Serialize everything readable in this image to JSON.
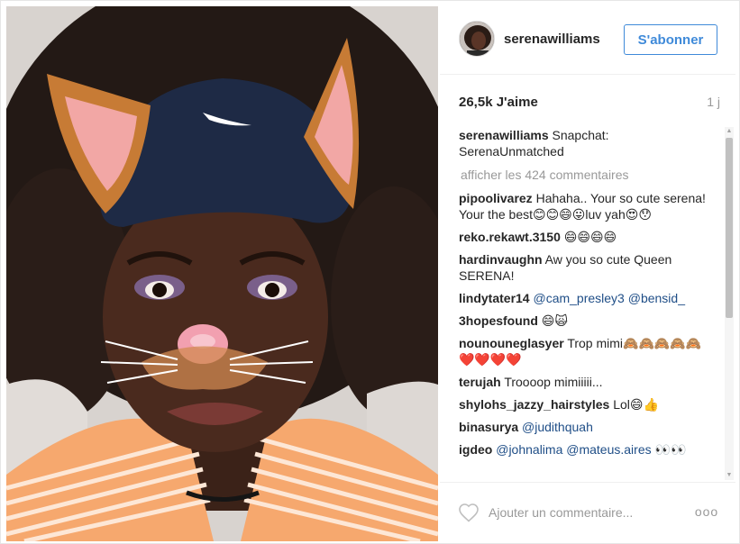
{
  "post": {
    "username": "serenawilliams",
    "follow_label": "S'abonner",
    "likes": "26,5k J'aime",
    "time_ago": "1 j"
  },
  "caption": {
    "username": "serenawilliams",
    "text": " Snapchat: SerenaUnmatched"
  },
  "load_more_label": "afficher les 424 commentaires",
  "comments": [
    {
      "user": "pipoolivarez",
      "text": " Hahaha.. Your so cute serena! Your the best😊😊😄😛luv yah😍😯",
      "mentions": ""
    },
    {
      "user": "reko.rekawt.3150",
      "text": " 😄😄😄😄",
      "mentions": ""
    },
    {
      "user": "hardinvaughn",
      "text": " Aw you so cute Queen SERENA!",
      "mentions": ""
    },
    {
      "user": "lindytater14",
      "text": " ",
      "mentions": "@cam_presley3 @bensid_"
    },
    {
      "user": "3hopesfound",
      "text": " 😄🙀",
      "mentions": ""
    },
    {
      "user": "nounouneglasyer",
      "text": " Trop mimi🙈🙈🙈🙈🙈❤️❤️❤️❤️",
      "mentions": ""
    },
    {
      "user": "terujah",
      "text": " Troooop mimiiiii...",
      "mentions": ""
    },
    {
      "user": "shylohs_jazzy_hairstyles",
      "text": " Lol😄👍",
      "mentions": ""
    },
    {
      "user": "binasurya",
      "text": " ",
      "mentions": "@judithquah"
    },
    {
      "user": "igdeo",
      "text": " ",
      "mentions": "@johnalima @mateus.aires 👀👀"
    }
  ],
  "comment_input": {
    "placeholder": "Ajouter un commentaire..."
  },
  "more_label": "ooo",
  "icons": {
    "like": "heart-outline-icon",
    "options": "more-options-icon",
    "scroll_up": "scroll-up-arrow-icon",
    "scroll_down": "scroll-down-arrow-icon"
  },
  "colors": {
    "follow_blue": "#3f8ad9",
    "mention_blue": "#1f4e87",
    "muted_gray": "#999999",
    "text_dark": "#262626"
  }
}
